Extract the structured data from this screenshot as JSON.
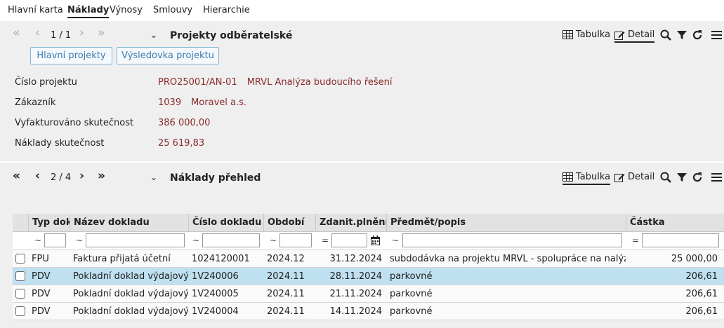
{
  "tabs": [
    "Hlavní karta",
    "Náklady",
    "Výnosy",
    "Smlouvy",
    "Hierarchie"
  ],
  "top_panel": {
    "pager": "1 / 1",
    "title": "Projekty odběratelské",
    "view_table": "Tabulka",
    "view_detail": "Detail",
    "buttons": [
      "Hlavní projekty",
      "Výsledovka projektu"
    ],
    "fields": [
      {
        "label": "Číslo projektu",
        "values": [
          "PRO25001/AN-01",
          "MRVL Analýza budoucího řešení"
        ]
      },
      {
        "label": "Zákazník",
        "values": [
          "1039",
          "Moravel a.s."
        ]
      },
      {
        "label": "Vyfakturováno skutečnost",
        "values": [
          "386 000,00"
        ]
      },
      {
        "label": "Náklady skutečnost",
        "values": [
          "25 619,83"
        ]
      }
    ]
  },
  "bottom_panel": {
    "pager": "2 / 4",
    "title": "Náklady přehled",
    "view_table": "Tabulka",
    "view_detail": "Detail"
  },
  "table": {
    "columns": [
      "Typ dokl.",
      "Název dokladu",
      "Číslo dokladu",
      "Období",
      "Zdanit.plnění",
      "Předmět/popis",
      "Částka"
    ],
    "filter_ops": [
      "~",
      "~",
      "~",
      "~",
      "=",
      "~",
      "="
    ],
    "rows": [
      [
        "FPU",
        "Faktura přijatá účetní",
        "1024120001",
        "2024.12",
        "31.12.2024",
        "subdodávka na projektu MRVL - spolupráce na nalýze",
        "25 000,00"
      ],
      [
        "PDV",
        "Pokladní doklad výdajový",
        "1V240006",
        "2024.11",
        "28.11.2024",
        "parkovné",
        "206,61"
      ],
      [
        "PDV",
        "Pokladní doklad výdajový",
        "1V240005",
        "2024.11",
        "21.11.2024",
        "parkovné",
        "206,61"
      ],
      [
        "PDV",
        "Pokladní doklad výdajový",
        "1V240004",
        "2024.11",
        "14.11.2024",
        "parkovné",
        "206,61"
      ]
    ],
    "selected_row": 1
  },
  "colors": {
    "value_text": "#8b2a2a",
    "link_button": "#3b7bb0",
    "selected_row": "#bfe0f0"
  }
}
